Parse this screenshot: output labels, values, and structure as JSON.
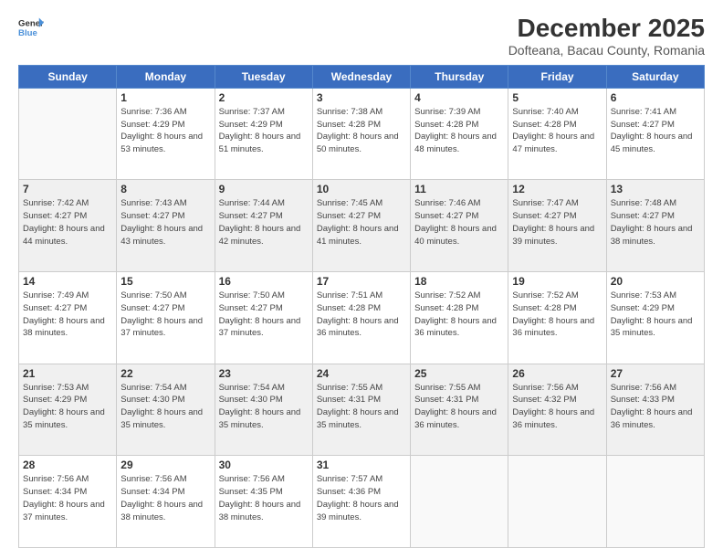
{
  "logo": {
    "line1": "General",
    "line2": "Blue"
  },
  "title": "December 2025",
  "location": "Dofteana, Bacau County, Romania",
  "weekdays": [
    "Sunday",
    "Monday",
    "Tuesday",
    "Wednesday",
    "Thursday",
    "Friday",
    "Saturday"
  ],
  "weeks": [
    [
      {
        "day": "",
        "empty": true
      },
      {
        "day": "1",
        "sunrise": "7:36 AM",
        "sunset": "4:29 PM",
        "daylight": "8 hours and 53 minutes."
      },
      {
        "day": "2",
        "sunrise": "7:37 AM",
        "sunset": "4:29 PM",
        "daylight": "8 hours and 51 minutes."
      },
      {
        "day": "3",
        "sunrise": "7:38 AM",
        "sunset": "4:28 PM",
        "daylight": "8 hours and 50 minutes."
      },
      {
        "day": "4",
        "sunrise": "7:39 AM",
        "sunset": "4:28 PM",
        "daylight": "8 hours and 48 minutes."
      },
      {
        "day": "5",
        "sunrise": "7:40 AM",
        "sunset": "4:28 PM",
        "daylight": "8 hours and 47 minutes."
      },
      {
        "day": "6",
        "sunrise": "7:41 AM",
        "sunset": "4:27 PM",
        "daylight": "8 hours and 45 minutes."
      }
    ],
    [
      {
        "day": "7",
        "sunrise": "7:42 AM",
        "sunset": "4:27 PM",
        "daylight": "8 hours and 44 minutes."
      },
      {
        "day": "8",
        "sunrise": "7:43 AM",
        "sunset": "4:27 PM",
        "daylight": "8 hours and 43 minutes."
      },
      {
        "day": "9",
        "sunrise": "7:44 AM",
        "sunset": "4:27 PM",
        "daylight": "8 hours and 42 minutes."
      },
      {
        "day": "10",
        "sunrise": "7:45 AM",
        "sunset": "4:27 PM",
        "daylight": "8 hours and 41 minutes."
      },
      {
        "day": "11",
        "sunrise": "7:46 AM",
        "sunset": "4:27 PM",
        "daylight": "8 hours and 40 minutes."
      },
      {
        "day": "12",
        "sunrise": "7:47 AM",
        "sunset": "4:27 PM",
        "daylight": "8 hours and 39 minutes."
      },
      {
        "day": "13",
        "sunrise": "7:48 AM",
        "sunset": "4:27 PM",
        "daylight": "8 hours and 38 minutes."
      }
    ],
    [
      {
        "day": "14",
        "sunrise": "7:49 AM",
        "sunset": "4:27 PM",
        "daylight": "8 hours and 38 minutes."
      },
      {
        "day": "15",
        "sunrise": "7:50 AM",
        "sunset": "4:27 PM",
        "daylight": "8 hours and 37 minutes."
      },
      {
        "day": "16",
        "sunrise": "7:50 AM",
        "sunset": "4:27 PM",
        "daylight": "8 hours and 37 minutes."
      },
      {
        "day": "17",
        "sunrise": "7:51 AM",
        "sunset": "4:28 PM",
        "daylight": "8 hours and 36 minutes."
      },
      {
        "day": "18",
        "sunrise": "7:52 AM",
        "sunset": "4:28 PM",
        "daylight": "8 hours and 36 minutes."
      },
      {
        "day": "19",
        "sunrise": "7:52 AM",
        "sunset": "4:28 PM",
        "daylight": "8 hours and 36 minutes."
      },
      {
        "day": "20",
        "sunrise": "7:53 AM",
        "sunset": "4:29 PM",
        "daylight": "8 hours and 35 minutes."
      }
    ],
    [
      {
        "day": "21",
        "sunrise": "7:53 AM",
        "sunset": "4:29 PM",
        "daylight": "8 hours and 35 minutes."
      },
      {
        "day": "22",
        "sunrise": "7:54 AM",
        "sunset": "4:30 PM",
        "daylight": "8 hours and 35 minutes."
      },
      {
        "day": "23",
        "sunrise": "7:54 AM",
        "sunset": "4:30 PM",
        "daylight": "8 hours and 35 minutes."
      },
      {
        "day": "24",
        "sunrise": "7:55 AM",
        "sunset": "4:31 PM",
        "daylight": "8 hours and 35 minutes."
      },
      {
        "day": "25",
        "sunrise": "7:55 AM",
        "sunset": "4:31 PM",
        "daylight": "8 hours and 36 minutes."
      },
      {
        "day": "26",
        "sunrise": "7:56 AM",
        "sunset": "4:32 PM",
        "daylight": "8 hours and 36 minutes."
      },
      {
        "day": "27",
        "sunrise": "7:56 AM",
        "sunset": "4:33 PM",
        "daylight": "8 hours and 36 minutes."
      }
    ],
    [
      {
        "day": "28",
        "sunrise": "7:56 AM",
        "sunset": "4:34 PM",
        "daylight": "8 hours and 37 minutes."
      },
      {
        "day": "29",
        "sunrise": "7:56 AM",
        "sunset": "4:34 PM",
        "daylight": "8 hours and 38 minutes."
      },
      {
        "day": "30",
        "sunrise": "7:56 AM",
        "sunset": "4:35 PM",
        "daylight": "8 hours and 38 minutes."
      },
      {
        "day": "31",
        "sunrise": "7:57 AM",
        "sunset": "4:36 PM",
        "daylight": "8 hours and 39 minutes."
      },
      {
        "day": "",
        "empty": true
      },
      {
        "day": "",
        "empty": true
      },
      {
        "day": "",
        "empty": true
      }
    ]
  ]
}
